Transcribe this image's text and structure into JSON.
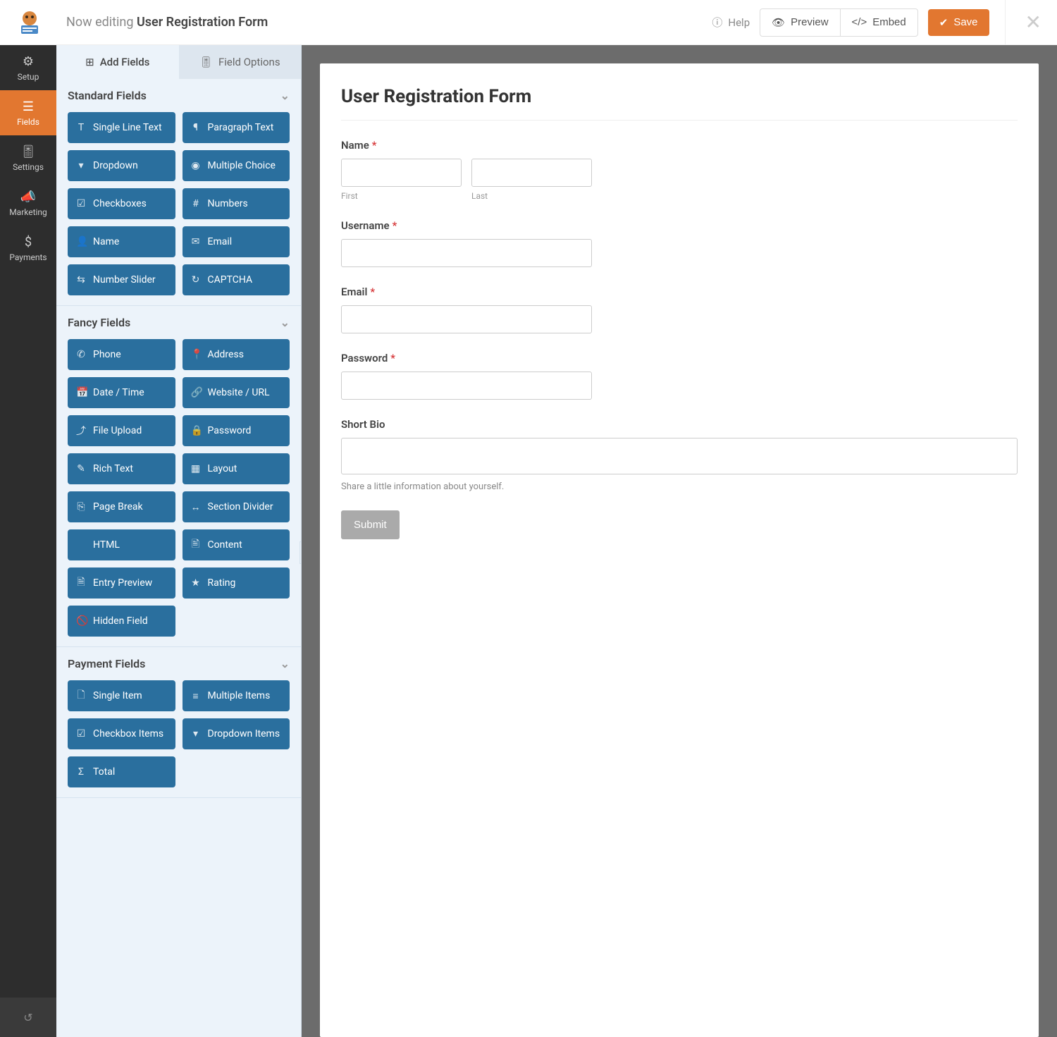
{
  "topbar": {
    "now_editing": "Now editing ",
    "form_title": "User Registration Form",
    "help": "Help",
    "preview": "Preview",
    "embed": "Embed",
    "save": "Save"
  },
  "nav": [
    {
      "key": "setup",
      "label": "Setup",
      "icon": "⚙"
    },
    {
      "key": "fields",
      "label": "Fields",
      "icon": "☰",
      "active": true
    },
    {
      "key": "settings",
      "label": "Settings",
      "icon": "🎚"
    },
    {
      "key": "marketing",
      "label": "Marketing",
      "icon": "📣"
    },
    {
      "key": "payments",
      "label": "Payments",
      "icon": "$"
    }
  ],
  "tabs": {
    "add_fields": "Add Fields",
    "field_options": "Field Options"
  },
  "groups": [
    {
      "key": "standard",
      "title": "Standard Fields",
      "fields": [
        {
          "icon": "T",
          "label": "Single Line Text",
          "name": "single-line-text"
        },
        {
          "icon": "¶",
          "label": "Paragraph Text",
          "name": "paragraph-text"
        },
        {
          "icon": "▾",
          "label": "Dropdown",
          "name": "dropdown"
        },
        {
          "icon": "◉",
          "label": "Multiple Choice",
          "name": "multiple-choice"
        },
        {
          "icon": "☑",
          "label": "Checkboxes",
          "name": "checkboxes"
        },
        {
          "icon": "#",
          "label": "Numbers",
          "name": "numbers"
        },
        {
          "icon": "👤",
          "label": "Name",
          "name": "name"
        },
        {
          "icon": "✉",
          "label": "Email",
          "name": "email"
        },
        {
          "icon": "⇆",
          "label": "Number Slider",
          "name": "number-slider"
        },
        {
          "icon": "↻",
          "label": "CAPTCHA",
          "name": "captcha"
        }
      ]
    },
    {
      "key": "fancy",
      "title": "Fancy Fields",
      "fields": [
        {
          "icon": "✆",
          "label": "Phone",
          "name": "phone"
        },
        {
          "icon": "📍",
          "label": "Address",
          "name": "address"
        },
        {
          "icon": "📅",
          "label": "Date / Time",
          "name": "date-time"
        },
        {
          "icon": "🔗",
          "label": "Website / URL",
          "name": "website-url"
        },
        {
          "icon": "⤴",
          "label": "File Upload",
          "name": "file-upload"
        },
        {
          "icon": "🔒",
          "label": "Password",
          "name": "password"
        },
        {
          "icon": "✎",
          "label": "Rich Text",
          "name": "rich-text"
        },
        {
          "icon": "▦",
          "label": "Layout",
          "name": "layout"
        },
        {
          "icon": "⎘",
          "label": "Page Break",
          "name": "page-break"
        },
        {
          "icon": "↔",
          "label": "Section Divider",
          "name": "section-divider"
        },
        {
          "icon": "</>",
          "label": "HTML",
          "name": "html"
        },
        {
          "icon": "🖹",
          "label": "Content",
          "name": "content"
        },
        {
          "icon": "🗎",
          "label": "Entry Preview",
          "name": "entry-preview"
        },
        {
          "icon": "★",
          "label": "Rating",
          "name": "rating"
        },
        {
          "icon": "🚫",
          "label": "Hidden Field",
          "name": "hidden-field"
        }
      ]
    },
    {
      "key": "payment",
      "title": "Payment Fields",
      "fields": [
        {
          "icon": "🗋",
          "label": "Single Item",
          "name": "single-item"
        },
        {
          "icon": "≡",
          "label": "Multiple Items",
          "name": "multiple-items"
        },
        {
          "icon": "☑",
          "label": "Checkbox Items",
          "name": "checkbox-items"
        },
        {
          "icon": "▾",
          "label": "Dropdown Items",
          "name": "dropdown-items"
        },
        {
          "icon": "Σ",
          "label": "Total",
          "name": "total"
        }
      ]
    }
  ],
  "form": {
    "title": "User Registration Form",
    "name_label": "Name",
    "first": "First",
    "last": "Last",
    "username_label": "Username",
    "email_label": "Email",
    "password_label": "Password",
    "bio_label": "Short Bio",
    "bio_hint": "Share a little information about yourself.",
    "submit": "Submit",
    "required_mark": "*"
  }
}
